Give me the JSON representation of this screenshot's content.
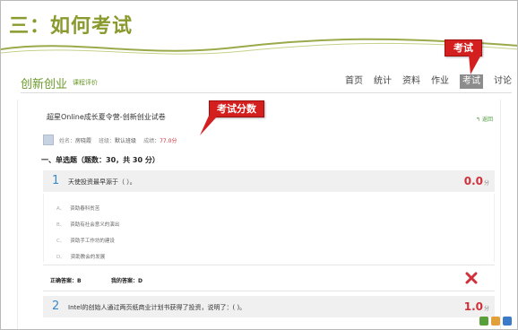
{
  "slide": {
    "title": "三：如何考试"
  },
  "nav": {
    "brand": "创新创业",
    "brand_sub": "课程评价",
    "menu": [
      "首页",
      "统计",
      "资料",
      "作业",
      "考试",
      "讨论"
    ],
    "active": "考试"
  },
  "callouts": {
    "exam": "考试",
    "score": "考试分数"
  },
  "paper": {
    "title": "超星Online成长夏令营-创新创业试卷",
    "back": "返回",
    "info": {
      "name_label": "姓名：",
      "name": "房晓霞",
      "class_label": "班级：",
      "class": "默认班级",
      "score_label": "成绩：",
      "score": "77.0分"
    },
    "section": "一、单选题（题数：30，共 30 分）",
    "questions": [
      {
        "num": "1",
        "text": "天使投资最早源于（ ）。",
        "score": "0.0",
        "unit": "分",
        "options": [
          {
            "letter": "A、",
            "text": "资助春科贫苦"
          },
          {
            "letter": "B、",
            "text": "资助有社会意义的演出"
          },
          {
            "letter": "C、",
            "text": "资助手工作坊的建设"
          },
          {
            "letter": "D、",
            "text": "资助教会的发展"
          }
        ],
        "correct_label": "正确答案：B",
        "mine_label": "我的答案：D"
      },
      {
        "num": "2",
        "text": "Intel的创始人通过两页纸商业计划书获得了投资，说明了：( )。",
        "score": "1.0",
        "unit": "分"
      }
    ]
  },
  "colors": {
    "accent_green": "#6a9a2a",
    "callout_red": "#d41f1f",
    "score_red": "#d0303a",
    "num_blue": "#3a8ac8"
  }
}
